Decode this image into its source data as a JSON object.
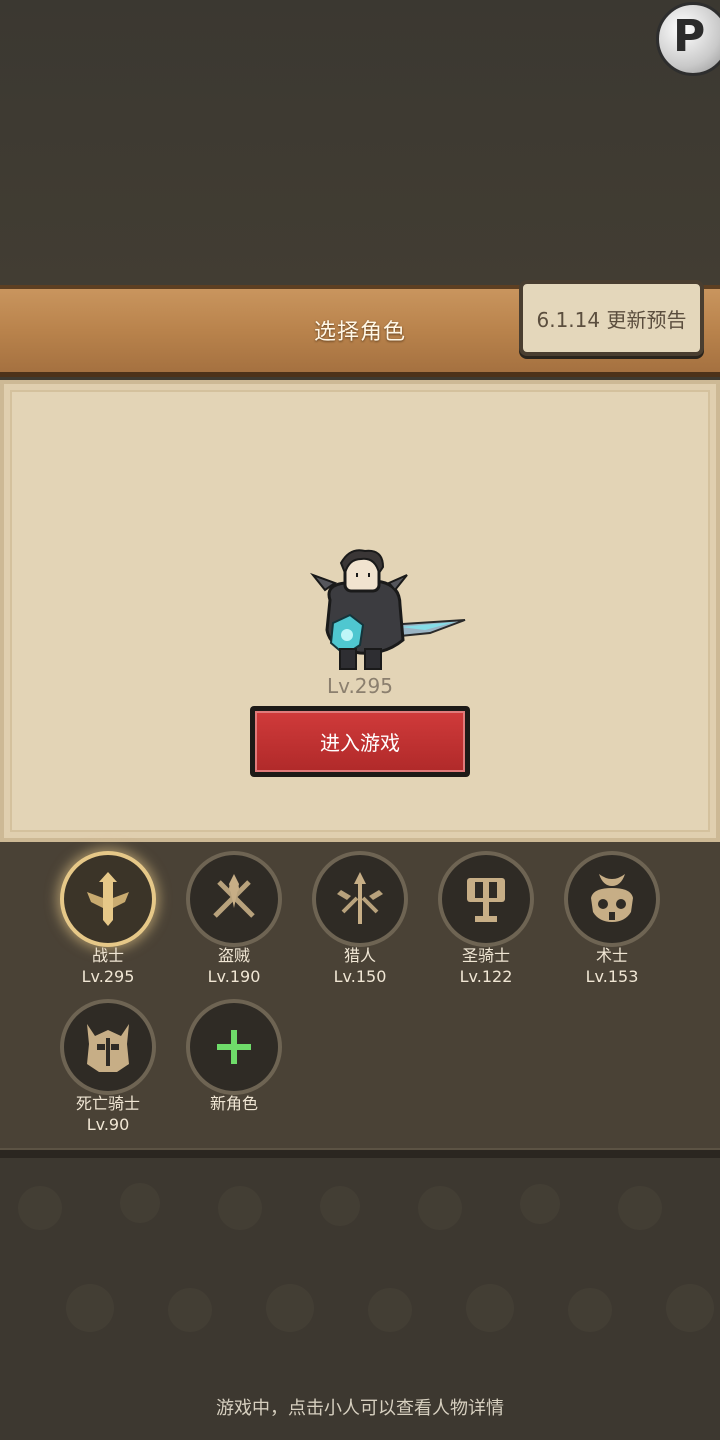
{
  "header": {
    "title": "选择角色",
    "update_notice": "6.1.14 更新预告"
  },
  "character": {
    "level": "Lv.295",
    "enter_button": "进入游戏"
  },
  "classes": [
    {
      "name": "战士",
      "level": "Lv.295",
      "icon": "warrior-icon",
      "selected": true
    },
    {
      "name": "盗贼",
      "level": "Lv.190",
      "icon": "rogue-icon",
      "selected": false
    },
    {
      "name": "猎人",
      "level": "Lv.150",
      "icon": "hunter-icon",
      "selected": false
    },
    {
      "name": "圣骑士",
      "level": "Lv.122",
      "icon": "paladin-icon",
      "selected": false
    },
    {
      "name": "术士",
      "level": "Lv.153",
      "icon": "warlock-icon",
      "selected": false
    },
    {
      "name": "死亡骑士",
      "level": "Lv.90",
      "icon": "death-knight-icon",
      "selected": false
    },
    {
      "name": "新角色",
      "level": "",
      "icon": "plus-icon",
      "selected": false
    }
  ],
  "footer": {
    "hint": "游戏中，点击小人可以查看人物详情"
  },
  "colors": {
    "accent_gold": "#e6c888",
    "button_red": "#b12a2a",
    "plus_green": "#6fdc6a"
  }
}
